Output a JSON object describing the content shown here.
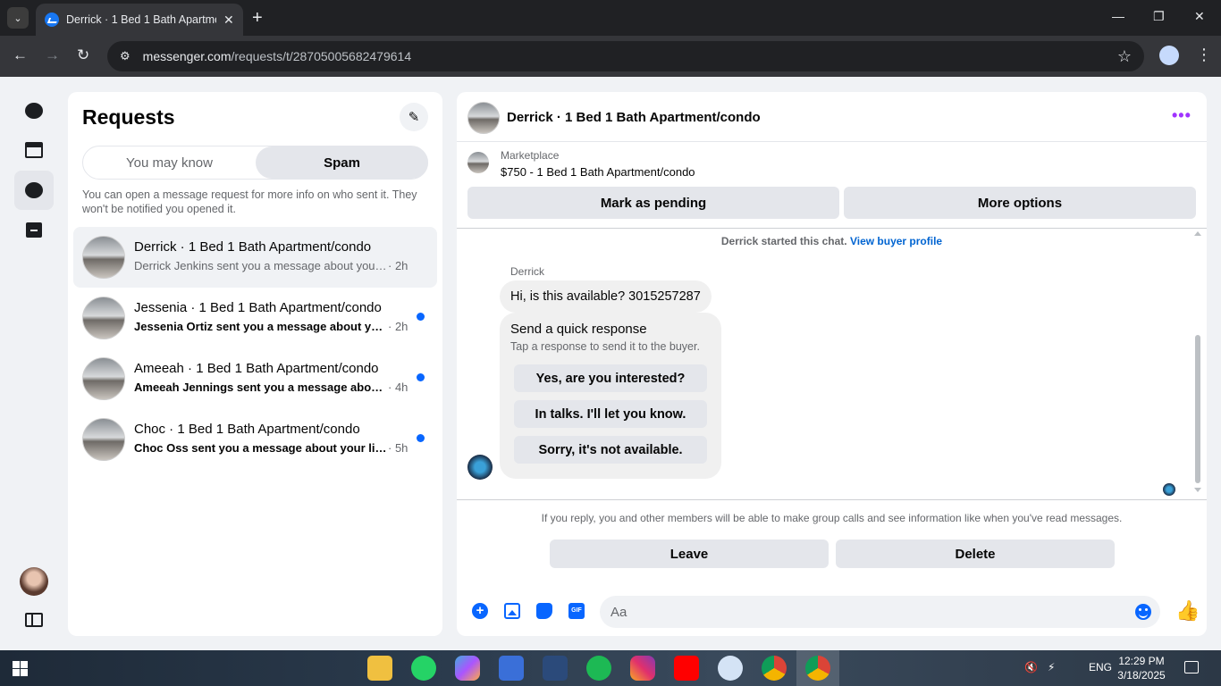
{
  "browser": {
    "tab_title": "Derrick · 1 Bed 1 Bath Apartment/condo",
    "url_domain": "messenger.com",
    "url_path": "/requests/t/28705005682479614"
  },
  "requests": {
    "title": "Requests",
    "tab_may_know": "You may know",
    "tab_spam": "Spam",
    "info": "You can open a message request for more info on who sent it. They won't be notified you opened it.",
    "items": [
      {
        "name": "Derrick · 1 Bed 1 Bath Apartment/condo",
        "snippet": "Derrick Jenkins sent you a message about your listing",
        "time": "· 2h",
        "unread": false
      },
      {
        "name": "Jessenia · 1 Bed 1 Bath Apartment/condo",
        "snippet": "Jessenia Ortiz sent you a message about your listing",
        "time": "· 2h",
        "unread": true
      },
      {
        "name": "Ameeah · 1 Bed 1 Bath Apartment/condo",
        "snippet": "Ameeah Jennings sent you a message about your listing",
        "time": "· 4h",
        "unread": true
      },
      {
        "name": "Choc · 1 Bed 1 Bath Apartment/condo",
        "snippet": "Choc Oss sent you a message about your listing",
        "time": "· 5h",
        "unread": true
      }
    ]
  },
  "chat": {
    "title": "Derrick · 1 Bed 1 Bath Apartment/condo",
    "marketplace_label": "Marketplace",
    "listing": "$750 - 1 Bed 1 Bath Apartment/condo",
    "mark_pending": "Mark as pending",
    "more_options": "More options",
    "started_text": "Derrick started this chat.",
    "view_profile": "View buyer profile",
    "sender": "Derrick",
    "message": "Hi, is this available? 3015257287",
    "quick_title": "Send a quick response",
    "quick_sub": "Tap a response to send it to the buyer.",
    "quick_replies": [
      "Yes, are you interested?",
      "In talks. I'll let you know.",
      "Sorry, it's not available."
    ],
    "reply_note": "If you reply, you and other members will be able to make group calls and see information like when you've read messages.",
    "leave": "Leave",
    "delete": "Delete",
    "composer_placeholder": "Aa",
    "gif_label": "GIF"
  },
  "taskbar": {
    "lang": "ENG",
    "time": "12:29 PM",
    "date": "3/18/2025"
  },
  "colors": {
    "accent": "#0866ff",
    "unread_dot": "#0866ff",
    "more_dots": "#a033ff"
  }
}
